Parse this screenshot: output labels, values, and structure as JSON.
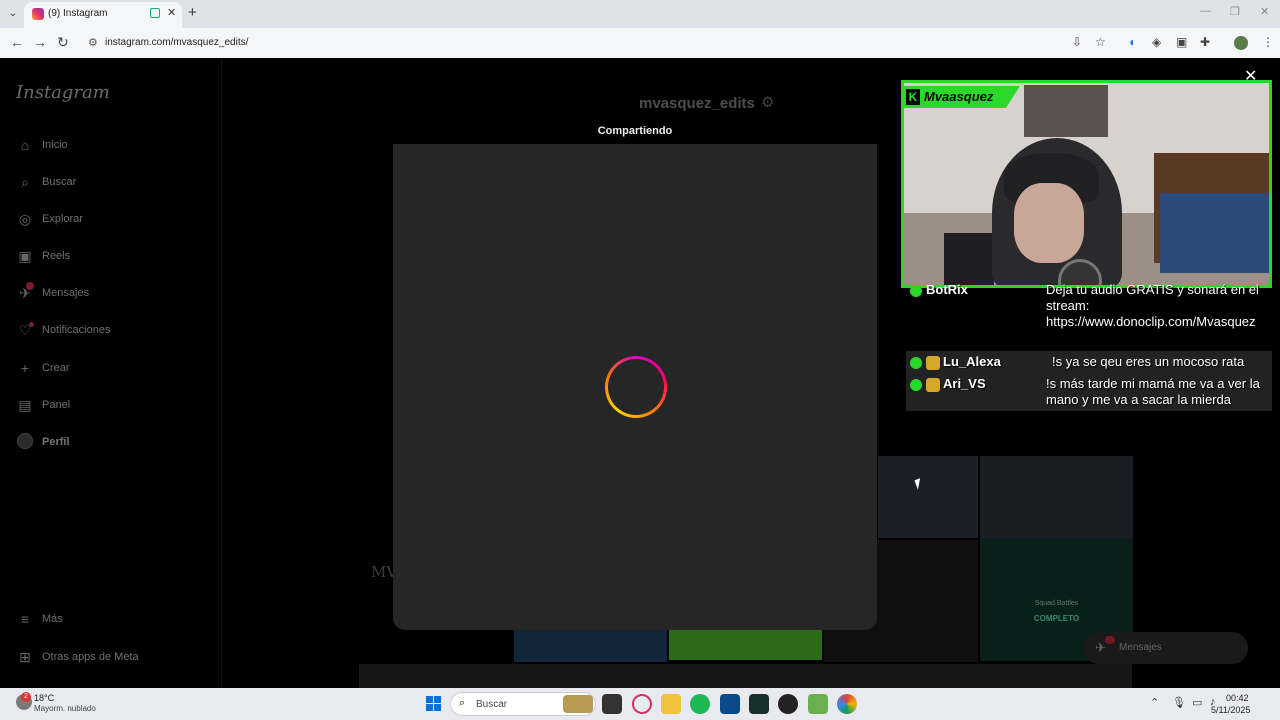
{
  "browser": {
    "tab_title": "(9) Instagram",
    "url": "instagram.com/mvasquez_edits/"
  },
  "sidebar": {
    "logo": "Instagram",
    "items": [
      {
        "label": "Inicio",
        "icon": "home-icon"
      },
      {
        "label": "Buscar",
        "icon": "search-icon"
      },
      {
        "label": "Explorar",
        "icon": "compass-icon"
      },
      {
        "label": "Reels",
        "icon": "reels-icon"
      },
      {
        "label": "Mensajes",
        "icon": "messenger-icon",
        "badge": "9+"
      },
      {
        "label": "Notificaciones",
        "icon": "heart-icon"
      },
      {
        "label": "Crear",
        "icon": "plus-icon"
      },
      {
        "label": "Panel",
        "icon": "chart-icon"
      },
      {
        "label": "Perfil",
        "icon": "avatar-icon"
      }
    ],
    "more": "Más",
    "meta_apps": "Otras apps de Meta"
  },
  "profile": {
    "username": "mvasquez_edits",
    "bg_partial_text": "MV",
    "squad_label": "Squad Battles",
    "squad_status": "COMPLETO"
  },
  "modal": {
    "title": "Compartiendo"
  },
  "messages_pill": {
    "label": "Mensajes",
    "badge": "9+"
  },
  "stream": {
    "streamer": "Mvaasquez",
    "chat": [
      {
        "user": "BotRix",
        "text": "Deja tu audio GRATIS y sonará en el stream: https://www.donoclip.com/Mvasquez"
      },
      {
        "user": "Lu_Alexa",
        "text": "!s ya se qeu eres un mocoso rata"
      },
      {
        "user": "Ari_VS",
        "text": "!s más tarde mi mamá me va a ver la mano y me va a sacar la mierda"
      }
    ],
    "accent_color": "#2ad82a"
  },
  "taskbar": {
    "weather_temp": "18°C",
    "weather_desc": "Mayorm. nublado",
    "weather_badge": "2",
    "search_label": "Buscar",
    "time": "00:42",
    "date": "5/11/2025"
  }
}
